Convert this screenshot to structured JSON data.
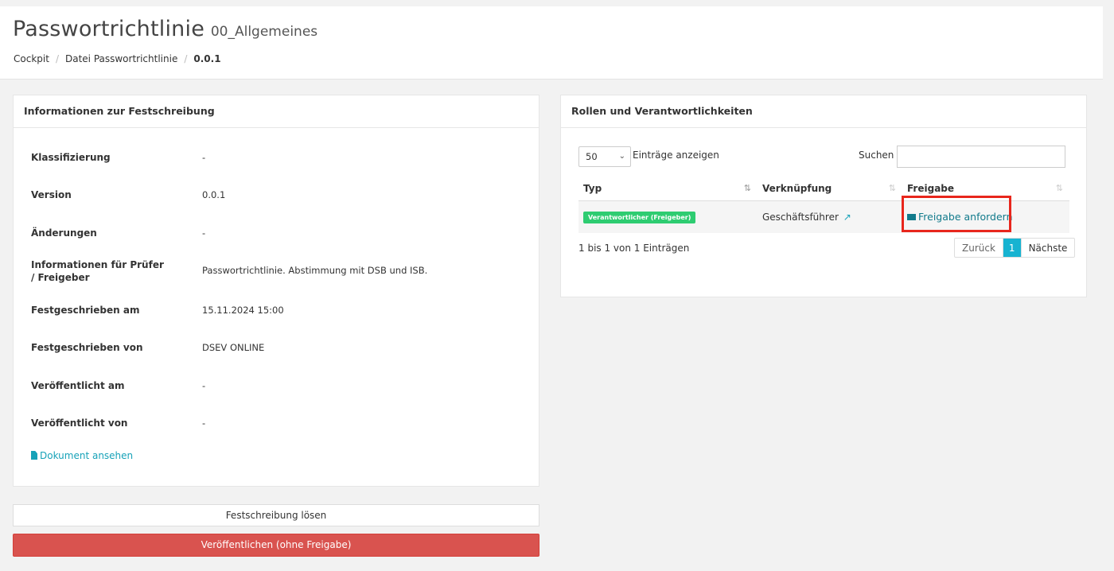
{
  "header": {
    "title": "Passwortrichtlinie",
    "subtitle": "00_Allgemeines",
    "breadcrumb": [
      "Cockpit",
      "Datei Passwortrichtlinie",
      "0.0.1"
    ]
  },
  "info_panel": {
    "title": "Informationen zur Festschreibung",
    "rows": [
      {
        "label": "Klassifizierung",
        "value": "-"
      },
      {
        "label": "Version",
        "value": "0.0.1"
      },
      {
        "label": "Änderungen",
        "value": "-"
      },
      {
        "label": "Informationen für Prüfer / Freigeber",
        "value": "Passwortrichtlinie. Abstimmung mit DSB und ISB."
      },
      {
        "label": "Festgeschrieben am",
        "value": "15.11.2024 15:00"
      },
      {
        "label": "Festgeschrieben von",
        "value": "DSEV ONLINE"
      },
      {
        "label": "Veröffentlicht am",
        "value": "-"
      },
      {
        "label": "Veröffentlicht von",
        "value": "-"
      }
    ],
    "document_link": "Dokument ansehen"
  },
  "roles_panel": {
    "title": "Rollen und Verantwortlichkeiten",
    "length_value": "50",
    "length_label": "Einträge anzeigen",
    "search_label": "Suchen",
    "search_value": "",
    "columns": [
      "Typ",
      "Verknüpfung",
      "Freigabe"
    ],
    "rows": [
      {
        "typ": "Verantwortlicher (Freigeber)",
        "verknuepfung": "Geschäftsführer",
        "freigabe": "Freigabe anfordern"
      }
    ],
    "info": "1 bis 1 von 1 Einträgen",
    "pagination": {
      "prev": "Zurück",
      "current": "1",
      "next": "Nächste"
    }
  },
  "actions": {
    "unlock": "Festschreibung lösen",
    "publish": "Veröffentlichen (ohne Freigabe)"
  },
  "colors": {
    "badge": "#2ecc71",
    "accent": "#17a2b8",
    "danger": "#d9534f",
    "highlight": "#e8261c"
  },
  "icons": {
    "document": "file-icon",
    "external": "external-link-icon",
    "mail": "envelope-icon"
  }
}
